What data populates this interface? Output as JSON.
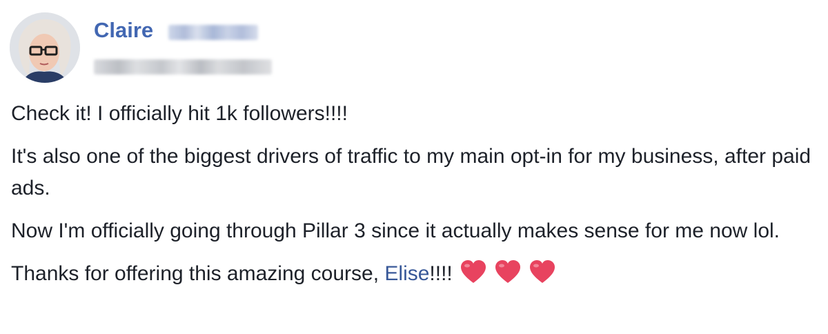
{
  "author": {
    "name": "Claire"
  },
  "post": {
    "paragraphs": [
      "Check it! I officially hit 1k followers!!!!",
      "It's also one of the biggest drivers of traffic to my main opt-in for my business, after paid ads.",
      "Now I'm officially going through Pillar 3 since it actually makes sense for me now lol."
    ],
    "last_line": {
      "prefix": "Thanks for offering this amazing course, ",
      "mention": "Elise",
      "suffix": "!!!!"
    },
    "emoji": [
      "heart-icon",
      "heart-icon",
      "heart-icon"
    ]
  },
  "colors": {
    "name": "#4267b2",
    "mention": "#385898",
    "text": "#1d2129",
    "heart": "#e8435f"
  }
}
